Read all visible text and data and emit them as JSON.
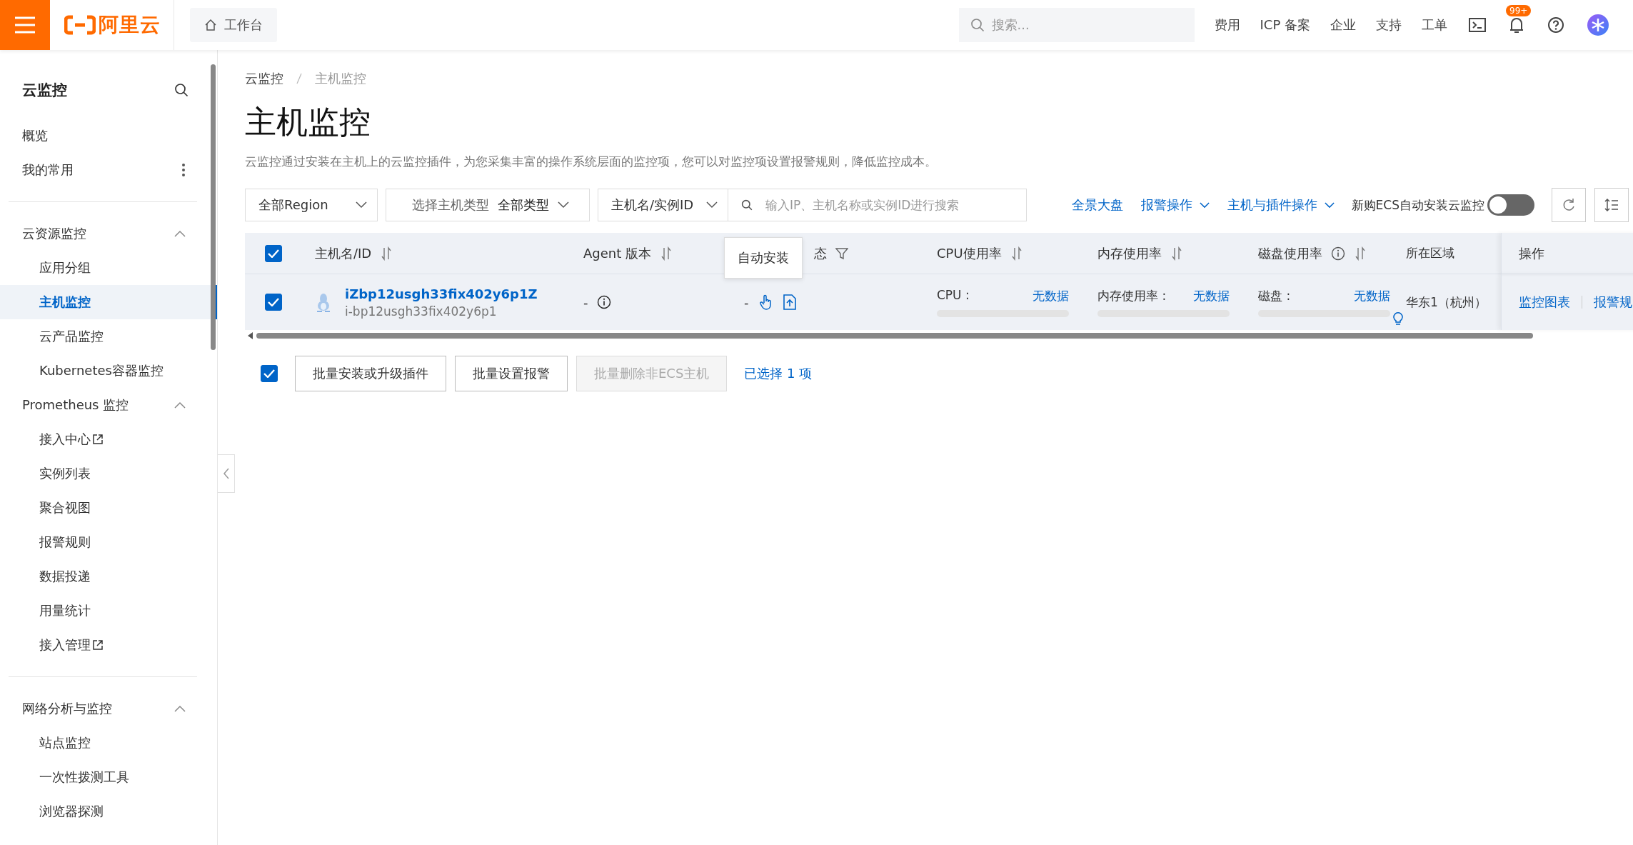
{
  "topbar": {
    "logo": "阿里云",
    "workbench": "工作台",
    "search_placeholder": "搜索...",
    "links": [
      "费用",
      "ICP 备案",
      "企业",
      "支持",
      "工单"
    ],
    "notification_badge": "99+"
  },
  "sidebar": {
    "title": "云监控",
    "top_items": [
      {
        "label": "概览",
        "has_menu": false
      },
      {
        "label": "我的常用",
        "has_menu": true
      }
    ],
    "groups": [
      {
        "sections": [
          {
            "label": "云资源监控",
            "expanded": true,
            "children": [
              {
                "label": "应用分组",
                "selected": false,
                "external": false
              },
              {
                "label": "主机监控",
                "selected": true,
                "external": false
              },
              {
                "label": "云产品监控",
                "selected": false,
                "external": false
              },
              {
                "label": "Kubernetes容器监控",
                "selected": false,
                "external": false
              }
            ]
          },
          {
            "label": "Prometheus 监控",
            "expanded": true,
            "children": [
              {
                "label": "接入中心",
                "selected": false,
                "external": true
              },
              {
                "label": "实例列表",
                "selected": false,
                "external": false
              },
              {
                "label": "聚合视图",
                "selected": false,
                "external": false
              },
              {
                "label": "报警规则",
                "selected": false,
                "external": false
              },
              {
                "label": "数据投递",
                "selected": false,
                "external": false
              },
              {
                "label": "用量统计",
                "selected": false,
                "external": false
              },
              {
                "label": "接入管理",
                "selected": false,
                "external": true
              }
            ]
          }
        ]
      },
      {
        "sections": [
          {
            "label": "网络分析与监控",
            "expanded": true,
            "children": [
              {
                "label": "站点监控",
                "selected": false,
                "external": false
              },
              {
                "label": "一次性拨测工具",
                "selected": false,
                "external": false
              },
              {
                "label": "浏览器探测",
                "selected": false,
                "external": false
              }
            ]
          }
        ]
      }
    ]
  },
  "breadcrumb": [
    "云监控",
    "主机监控"
  ],
  "title": "主机监控",
  "description": "云监控通过安装在主机上的云监控插件，为您采集丰富的操作系统层面的监控项，您可以对监控项设置报警规则，降低监控成本。",
  "filters": {
    "region": "全部Region",
    "host_type_label": "选择主机类型",
    "host_type_value": "全部类型",
    "search_field": "主机名/实例ID",
    "search_placeholder": "输入IP、主机名称或实例ID进行搜索"
  },
  "actions": [
    {
      "label": "全景大盘",
      "dropdown": false
    },
    {
      "label": "报警操作",
      "dropdown": true
    },
    {
      "label": "主机与插件操作",
      "dropdown": true
    }
  ],
  "auto_install": {
    "label": "新购ECS自动安装云监控",
    "on": false
  },
  "table": {
    "select_all_checked": true,
    "columns": [
      {
        "label": "主机名/ID",
        "sortable": true,
        "info": false,
        "filter": false
      },
      {
        "label": "Agent 版本",
        "sortable": true,
        "info": false,
        "filter": false
      },
      {
        "label": "态",
        "sortable": false,
        "info": false,
        "filter": true
      },
      {
        "label": "CPU使用率",
        "sortable": true,
        "info": false,
        "filter": false
      },
      {
        "label": "内存使用率",
        "sortable": true,
        "info": false,
        "filter": false
      },
      {
        "label": "磁盘使用率",
        "sortable": true,
        "info": true,
        "filter": false
      },
      {
        "label": "所在区域",
        "sortable": false,
        "info": false,
        "filter": false
      },
      {
        "label": "操作",
        "sortable": false,
        "info": false,
        "filter": false
      }
    ],
    "rows": [
      {
        "checked": true,
        "host_name": "iZbp12usgh33fix402y6p1Z",
        "instance_id": "i-bp12usgh33fix402y6p1",
        "agent_version": "-",
        "status": "-",
        "metrics": [
          {
            "label": "CPU :",
            "value": "无数据",
            "level": 0
          },
          {
            "label": "内存使用率 :",
            "value": "无数据",
            "level": 0
          },
          {
            "label": "磁盘 :",
            "value": "无数据",
            "level": 0
          }
        ],
        "region": "华东1（杭州）",
        "operations": [
          "监控图表",
          "报警规"
        ]
      }
    ]
  },
  "tooltip": "自动安装",
  "batch": {
    "checked": true,
    "buttons": [
      {
        "label": "批量安装或升级插件",
        "disabled": false
      },
      {
        "label": "批量设置报警",
        "disabled": false
      },
      {
        "label": "批量删除非ECS主机",
        "disabled": true
      }
    ],
    "selection": "已选择 1 项"
  }
}
